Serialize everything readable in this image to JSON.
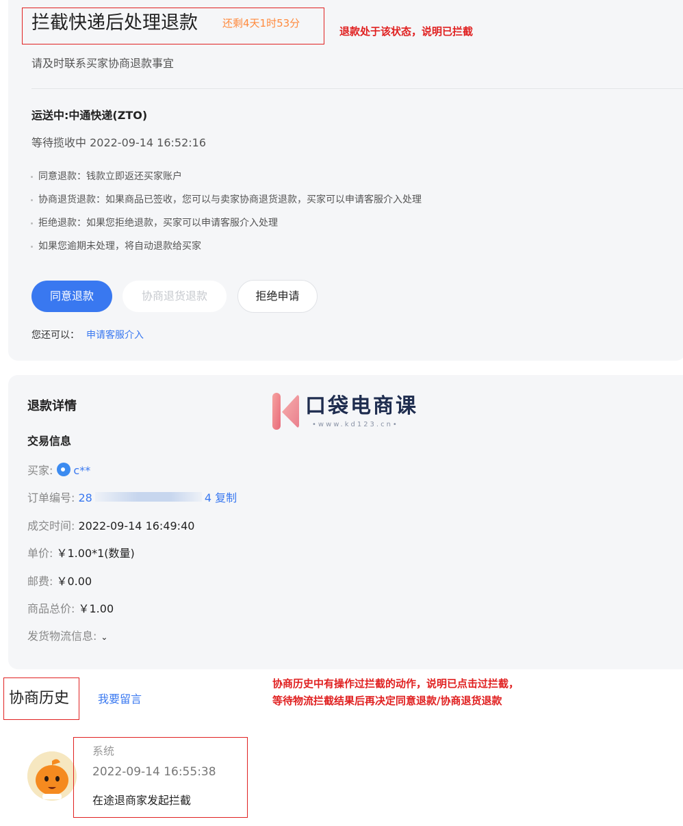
{
  "status": {
    "title": "拦截快递后处理退款",
    "countdown": "还剩4天1时53分",
    "annotation": "退款处于该状态，说明已拦截",
    "subtitle": "请及时联系买家协商退款事宜",
    "shipping_title": "运送中:中通快递(ZTO)",
    "shipping_status": "等待揽收中 2022-09-14 16:52:16",
    "bullets": [
      "同意退款：钱款立即返还买家账户",
      "协商退货退款：如果商品已签收，您可以与卖家协商退货退款，买家可以申请客服介入处理",
      "拒绝退款：如果您拒绝退款，买家可以申请客服介入处理",
      "如果您逾期未处理，将自动退款给买家"
    ],
    "buttons": {
      "agree": "同意退款",
      "negotiate": "协商退货退款",
      "reject": "拒绝申请"
    },
    "more_label": "您还可以：",
    "more_link": "申请客服介入"
  },
  "details": {
    "title": "退款详情",
    "subtitle": "交易信息",
    "buyer_label": "买家:",
    "buyer_name": "c**",
    "order_label": "订单编号:",
    "order_prefix": "28",
    "order_suffix": "4",
    "copy": "复制",
    "deal_time_label": "成交时间:",
    "deal_time": "2022-09-14 16:49:40",
    "price_label": "单价:",
    "price": "￥1.00*1(数量)",
    "postage_label": "邮费:",
    "postage": "￥0.00",
    "total_label": "商品总价:",
    "total": "￥1.00",
    "logistics_label": "发货物流信息:"
  },
  "watermark": {
    "brand": "口袋电商课",
    "url": "•www.kd123.cn•"
  },
  "history": {
    "title": "协商历史",
    "leave_message": "我要留言",
    "annotation_line1": "协商历史中有操作过拦截的动作，说明已点击过拦截，",
    "annotation_line2": "等待物流拦截结果后再决定同意退款/协商退货退款",
    "entry": {
      "author": "系统",
      "time": "2022-09-14 16:55:38",
      "text": "在途退商家发起拦截"
    }
  },
  "colors": {
    "accent": "#3978f0",
    "countdown": "#ff8a3d",
    "annotation": "#e02020",
    "card_bg": "#f5f6f8"
  }
}
